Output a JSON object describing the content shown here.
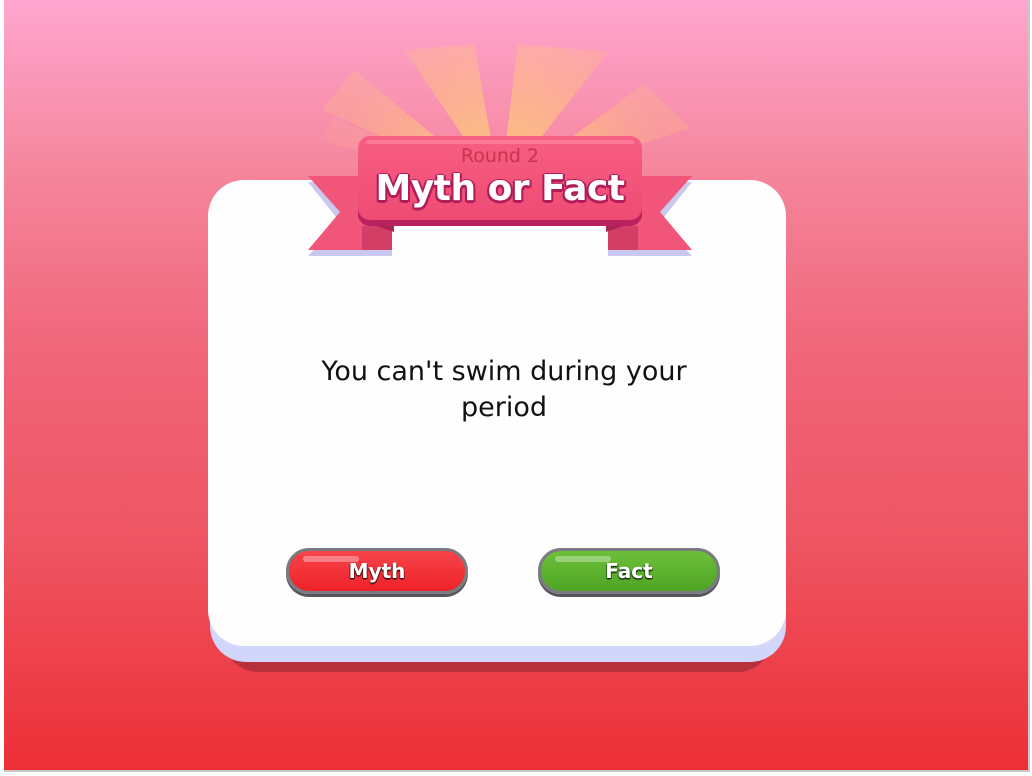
{
  "badge": {
    "round_label": "Round 2",
    "title": "Myth or Fact"
  },
  "question": {
    "text": "You can't swim during your period"
  },
  "buttons": {
    "myth_label": "Myth",
    "fact_label": "Fact"
  },
  "colors": {
    "background_top": "#ffa6cf",
    "background_bottom": "#ed2f36",
    "ribbon": "#f3557a",
    "myth_button": "#ee2229",
    "fact_button": "#4ea524",
    "card": "#fefeff"
  }
}
